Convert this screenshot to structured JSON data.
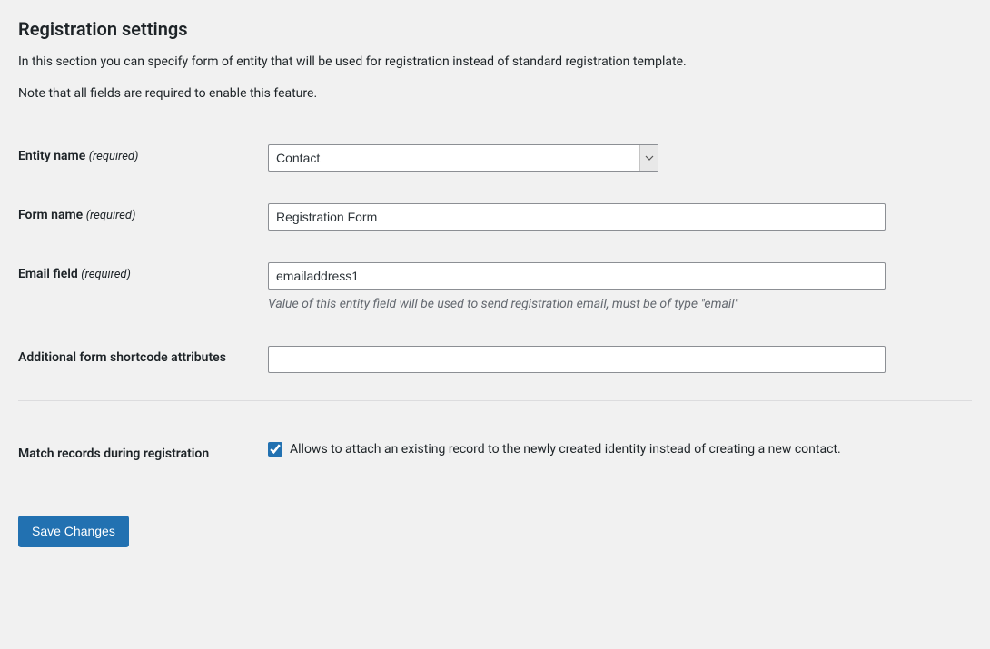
{
  "heading": "Registration settings",
  "intro1": "In this section you can specify form of entity that will be used for registration instead of standard registration template.",
  "intro2": "Note that all fields are required to enable this feature.",
  "fields": {
    "entityName": {
      "label": "Entity name",
      "required": "(required)",
      "value": "Contact"
    },
    "formName": {
      "label": "Form name",
      "required": "(required)",
      "value": "Registration Form"
    },
    "emailField": {
      "label": "Email field",
      "required": "(required)",
      "value": "emailaddress1",
      "description": "Value of this entity field will be used to send registration email, must be of type \"email\""
    },
    "additionalAttrs": {
      "label": "Additional form shortcode attributes",
      "value": ""
    },
    "matchRecords": {
      "label": "Match records during registration",
      "checked": true,
      "checkboxLabel": "Allows to attach an existing record to the newly created identity instead of creating a new contact."
    }
  },
  "submit": {
    "label": "Save Changes"
  }
}
